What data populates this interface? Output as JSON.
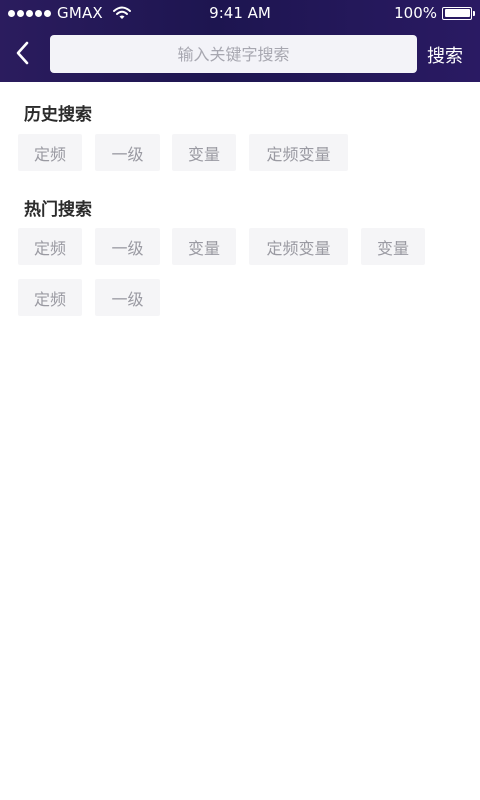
{
  "status_bar": {
    "carrier": "GMAX",
    "time": "9:41 AM",
    "battery": "100%"
  },
  "search": {
    "placeholder": "输入关键字搜索",
    "button_label": "搜索"
  },
  "history": {
    "title": "历史搜索",
    "tags": [
      "定频",
      "一级",
      "变量",
      "定频变量"
    ]
  },
  "hot": {
    "title": "热门搜索",
    "tags": [
      "定频",
      "一级",
      "变量",
      "定频变量",
      "变量",
      "定频",
      "一级"
    ]
  },
  "icons": {
    "back": "chevron-left-icon",
    "wifi": "wifi-icon",
    "battery": "battery-icon",
    "signal": "signal-dots-icon"
  },
  "colors": {
    "header_bg": "#1d1550",
    "tag_bg": "#f5f5f7",
    "tag_text": "#9a9aa2",
    "title_text": "#2b2b2b"
  }
}
